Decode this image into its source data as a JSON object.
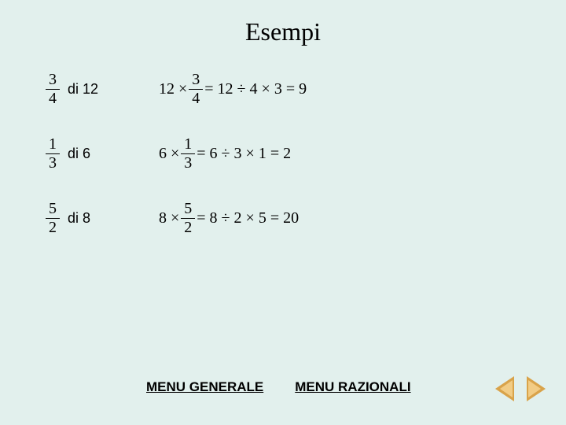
{
  "title": "Esempi",
  "rows": [
    {
      "lhs": {
        "num": "3",
        "den": "4",
        "di": "di 12"
      },
      "rhs": {
        "pre": "12 ×",
        "num": "3",
        "den": "4",
        "post": "= 12 ÷ 4 × 3 = 9"
      }
    },
    {
      "lhs": {
        "num": "1",
        "den": "3",
        "di": "di  6"
      },
      "rhs": {
        "pre": "6 ×",
        "num": "1",
        "den": "3",
        "post": "= 6 ÷ 3 × 1 = 2"
      }
    },
    {
      "lhs": {
        "num": "5",
        "den": "2",
        "di": "di  8"
      },
      "rhs": {
        "pre": "8 ×",
        "num": "5",
        "den": "2",
        "post": "= 8 ÷ 2 × 5 = 20"
      }
    }
  ],
  "links": {
    "generale": "MENU GENERALE",
    "razionali": "MENU RAZIONALI"
  }
}
